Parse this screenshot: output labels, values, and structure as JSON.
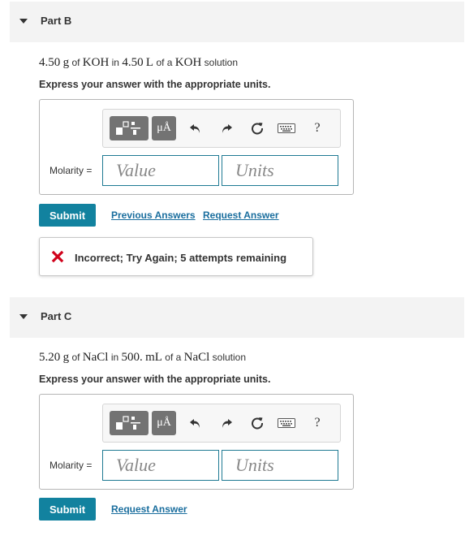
{
  "partB": {
    "title": "Part B",
    "problem": {
      "mass": "4.50",
      "mass_unit": "g",
      "of1": "of",
      "compound": "KOH",
      "in": "in",
      "volume": "4.50",
      "volume_unit": "L",
      "of2": "of a",
      "solution_compound": "KOH",
      "suffix": "solution"
    },
    "instruction": "Express your answer with the appropriate units.",
    "toolbar": {
      "units_label": "μÅ",
      "help_label": "?"
    },
    "molarity_label": "Molarity =",
    "value_placeholder": "Value",
    "units_placeholder": "Units",
    "submit_label": "Submit",
    "previous_answers_label": "Previous Answers",
    "request_answer_label": "Request Answer",
    "feedback": "Incorrect; Try Again; 5 attempts remaining"
  },
  "partC": {
    "title": "Part C",
    "problem": {
      "mass": "5.20",
      "mass_unit": "g",
      "of1": "of",
      "compound": "NaCl",
      "in": "in",
      "volume": "500.",
      "volume_unit": "mL",
      "of2": "of a",
      "solution_compound": "NaCl",
      "suffix": "solution"
    },
    "instruction": "Express your answer with the appropriate units.",
    "toolbar": {
      "units_label": "μÅ",
      "help_label": "?"
    },
    "molarity_label": "Molarity =",
    "value_placeholder": "Value",
    "units_placeholder": "Units",
    "submit_label": "Submit",
    "request_answer_label": "Request Answer"
  },
  "colors": {
    "accent": "#12829f",
    "link": "#1a6e9e",
    "error": "#d0021b",
    "header_bg": "#f3f3f3"
  },
  "icons": [
    "caret-down-icon",
    "templates-icon",
    "units-icon",
    "undo-icon",
    "redo-icon",
    "reset-icon",
    "keyboard-icon",
    "help-icon",
    "error-x-icon"
  ]
}
